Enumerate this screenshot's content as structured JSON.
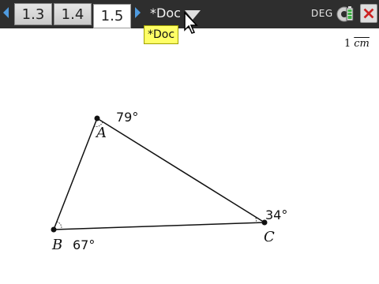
{
  "tabs": [
    {
      "label": "1.3"
    },
    {
      "label": "1.4"
    },
    {
      "label": "1.5",
      "active": true
    }
  ],
  "document": {
    "title": "*Doc"
  },
  "tooltip": {
    "text": "*Doc"
  },
  "status": {
    "mode": "DEG"
  },
  "scale": {
    "value": "1",
    "unit": "cm"
  },
  "triangle": {
    "vertices": [
      {
        "name": "A",
        "angle": "79°"
      },
      {
        "name": "B",
        "angle": "67°"
      },
      {
        "name": "C",
        "angle": "34°"
      }
    ]
  },
  "colors": {
    "topbar": "#2e2e2e",
    "nav_arrow": "#4f9be0",
    "close_x": "#cc2222",
    "tooltip_bg": "#ffff66"
  },
  "icons": [
    "nav-left-arrow-icon",
    "nav-right-arrow-icon",
    "dropdown-icon",
    "gear-battery-icon",
    "close-icon",
    "mouse-cursor-icon"
  ]
}
